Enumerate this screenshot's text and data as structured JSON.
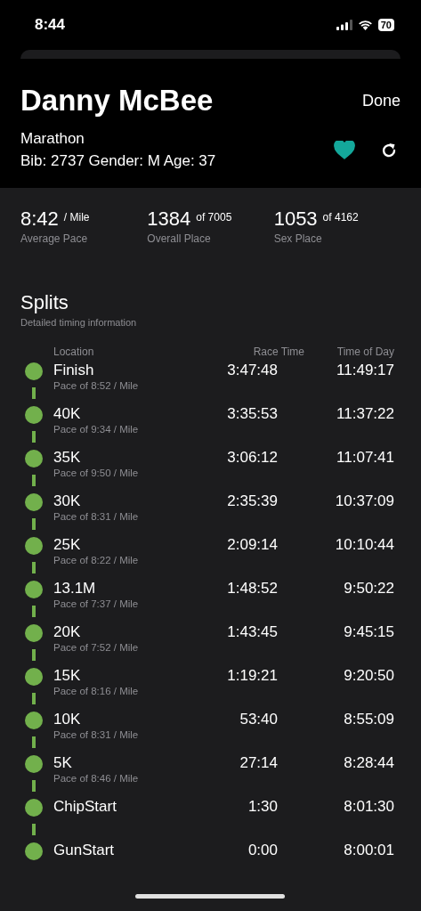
{
  "status_bar": {
    "time": "8:44",
    "battery": "70"
  },
  "header": {
    "name": "Danny McBee",
    "done": "Done",
    "event": "Marathon",
    "details": "Bib: 2737 Gender: M Age: 37",
    "favorite": true
  },
  "stats": [
    {
      "value": "8:42",
      "unit": "/ Mile",
      "label": "Average Pace"
    },
    {
      "value": "1384",
      "unit": "of 7005",
      "label": "Overall Place"
    },
    {
      "value": "1053",
      "unit": "of 4162",
      "label": "Sex Place"
    }
  ],
  "splits": {
    "title": "Splits",
    "subtitle": "Detailed timing information",
    "columns": [
      "Location",
      "Race Time",
      "Time of Day"
    ],
    "rows": [
      {
        "location": "Finish",
        "pace": "Pace of 8:52 / Mile",
        "race_time": "3:47:48",
        "time_of_day": "11:49:17"
      },
      {
        "location": "40K",
        "pace": "Pace of 9:34 / Mile",
        "race_time": "3:35:53",
        "time_of_day": "11:37:22"
      },
      {
        "location": "35K",
        "pace": "Pace of 9:50 / Mile",
        "race_time": "3:06:12",
        "time_of_day": "11:07:41"
      },
      {
        "location": "30K",
        "pace": "Pace of 8:31 / Mile",
        "race_time": "2:35:39",
        "time_of_day": "10:37:09"
      },
      {
        "location": "25K",
        "pace": "Pace of 8:22 / Mile",
        "race_time": "2:09:14",
        "time_of_day": "10:10:44"
      },
      {
        "location": "13.1M",
        "pace": "Pace of 7:37 / Mile",
        "race_time": "1:48:52",
        "time_of_day": "9:50:22"
      },
      {
        "location": "20K",
        "pace": "Pace of 7:52 / Mile",
        "race_time": "1:43:45",
        "time_of_day": "9:45:15"
      },
      {
        "location": "15K",
        "pace": "Pace of 8:16 / Mile",
        "race_time": "1:19:21",
        "time_of_day": "9:20:50"
      },
      {
        "location": "10K",
        "pace": "Pace of 8:31 / Mile",
        "race_time": "53:40",
        "time_of_day": "8:55:09"
      },
      {
        "location": "5K",
        "pace": "Pace of 8:46 / Mile",
        "race_time": "27:14",
        "time_of_day": "8:28:44"
      },
      {
        "location": "ChipStart",
        "race_time": "1:30",
        "time_of_day": "8:01:30"
      },
      {
        "location": "GunStart",
        "race_time": "0:00",
        "time_of_day": "8:00:01"
      }
    ]
  }
}
